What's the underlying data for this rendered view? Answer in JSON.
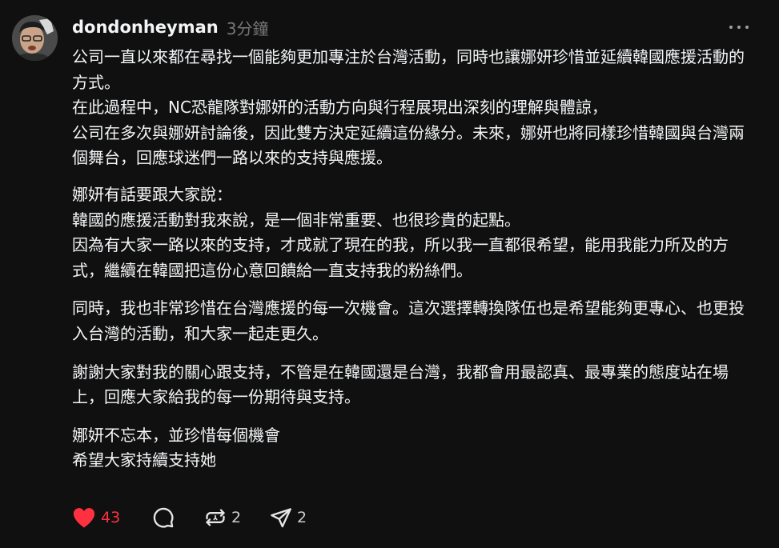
{
  "post": {
    "author": {
      "username": "dondonheyman",
      "avatar_icon": "user-avatar"
    },
    "timestamp": "3分鐘",
    "more_icon": "more-horizontal-icon",
    "paragraphs": [
      "公司一直以來都在尋找一個能夠更加專注於台灣活動，同時也讓娜妍珍惜並延續韓國應援活動的方式。\n在此過程中，NC恐龍隊對娜妍的活動方向與行程展現出深刻的理解與體諒，\n公司在多次與娜妍討論後，因此雙方決定延續這份緣分。未來，娜妍也將同樣珍惜韓國與台灣兩個舞台，回應球迷們一路以來的支持與應援。",
      "娜妍有話要跟大家說：\n韓國的應援活動對我來說，是一個非常重要、也很珍貴的起點。\n因為有大家一路以來的支持，才成就了現在的我，所以我一直都很希望，能用我能力所及的方式，繼續在韓國把這份心意回饋給一直支持我的粉絲們。",
      "同時，我也非常珍惜在台灣應援的每一次機會。這次選擇轉換隊伍也是希望能夠更專心、也更投入台灣的活動，和大家一起走更久。",
      "謝謝大家對我的關心跟支持，不管是在韓國還是台灣，我都會用最認真、最專業的態度站在場上，回應大家給我的每一份期待與支持。",
      "娜妍不忘本，並珍惜每個機會\n希望大家持續支持她"
    ],
    "actions": {
      "like": {
        "icon": "heart-filled-icon",
        "count": "43",
        "color": "#ff3040"
      },
      "reply": {
        "icon": "comment-icon"
      },
      "repost": {
        "icon": "repost-icon",
        "count": "2"
      },
      "share": {
        "icon": "send-icon",
        "count": "2"
      }
    }
  }
}
